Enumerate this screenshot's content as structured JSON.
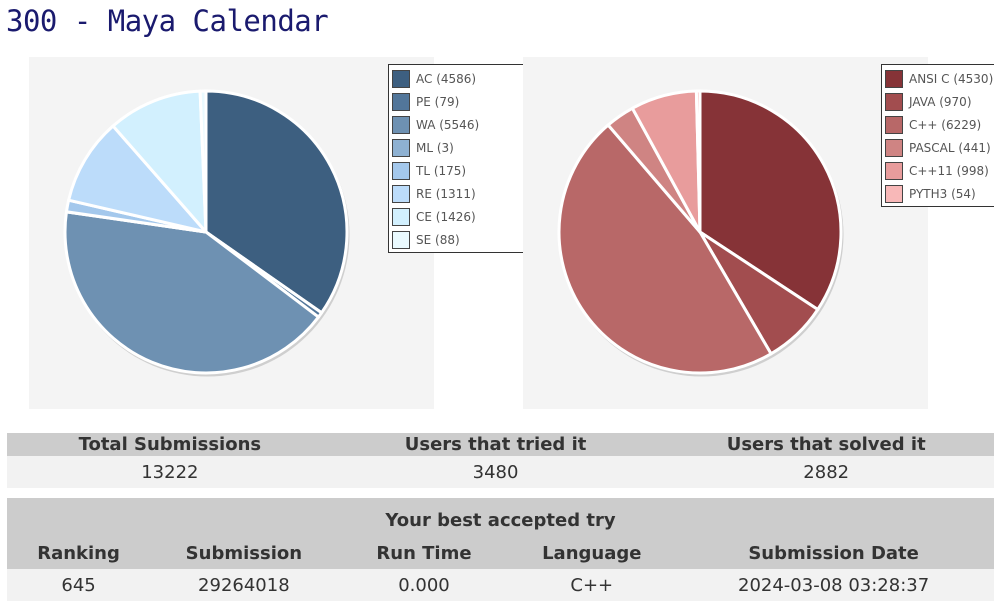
{
  "page": {
    "title": "300 - Maya Calendar"
  },
  "chart_data": [
    {
      "type": "pie",
      "legend_position": "right",
      "slices": [
        {
          "label": "AC",
          "value": 4586,
          "color": "#3d5f80"
        },
        {
          "label": "PE",
          "value": 79,
          "color": "#52769a"
        },
        {
          "label": "WA",
          "value": 5546,
          "color": "#6e91b2"
        },
        {
          "label": "ML",
          "value": 3,
          "color": "#8eb1d2"
        },
        {
          "label": "TL",
          "value": 175,
          "color": "#a4c8ec"
        },
        {
          "label": "RE",
          "value": 1311,
          "color": "#bcdcfa"
        },
        {
          "label": "CE",
          "value": 1426,
          "color": "#d2f0fe"
        },
        {
          "label": "SE",
          "value": 88,
          "color": "#eafaff"
        }
      ],
      "legend_entries": [
        "AC (4586)",
        "PE (79)",
        "WA (5546)",
        "ML (3)",
        "TL (175)",
        "RE (1311)",
        "CE (1426)",
        "SE (88)"
      ]
    },
    {
      "type": "pie",
      "legend_position": "right",
      "slices": [
        {
          "label": "ANSI C",
          "value": 4530,
          "color": "#863337"
        },
        {
          "label": "JAVA",
          "value": 970,
          "color": "#a24d4f"
        },
        {
          "label": "C++",
          "value": 6229,
          "color": "#b86868"
        },
        {
          "label": "PASCAL",
          "value": 441,
          "color": "#cf8483"
        },
        {
          "label": "C++11",
          "value": 998,
          "color": "#e89c9c"
        },
        {
          "label": "PYTH3",
          "value": 54,
          "color": "#f8b8b8"
        }
      ],
      "legend_entries": [
        "ANSI C (4530)",
        "JAVA (970)",
        "C++ (6229)",
        "PASCAL (441)",
        "C++11 (998)",
        "PYTH3 (54)"
      ]
    }
  ],
  "summary": {
    "headers": [
      "Total Submissions",
      "Users that tried it",
      "Users that solved it"
    ],
    "values": [
      "13222",
      "3480",
      "2882"
    ]
  },
  "best_try": {
    "title": "Your best accepted try",
    "headers": [
      "Ranking",
      "Submission",
      "Run Time",
      "Language",
      "Submission Date"
    ],
    "values": [
      "645",
      "29264018",
      "0.000",
      "C++",
      "2024-03-08 03:28:37"
    ]
  }
}
